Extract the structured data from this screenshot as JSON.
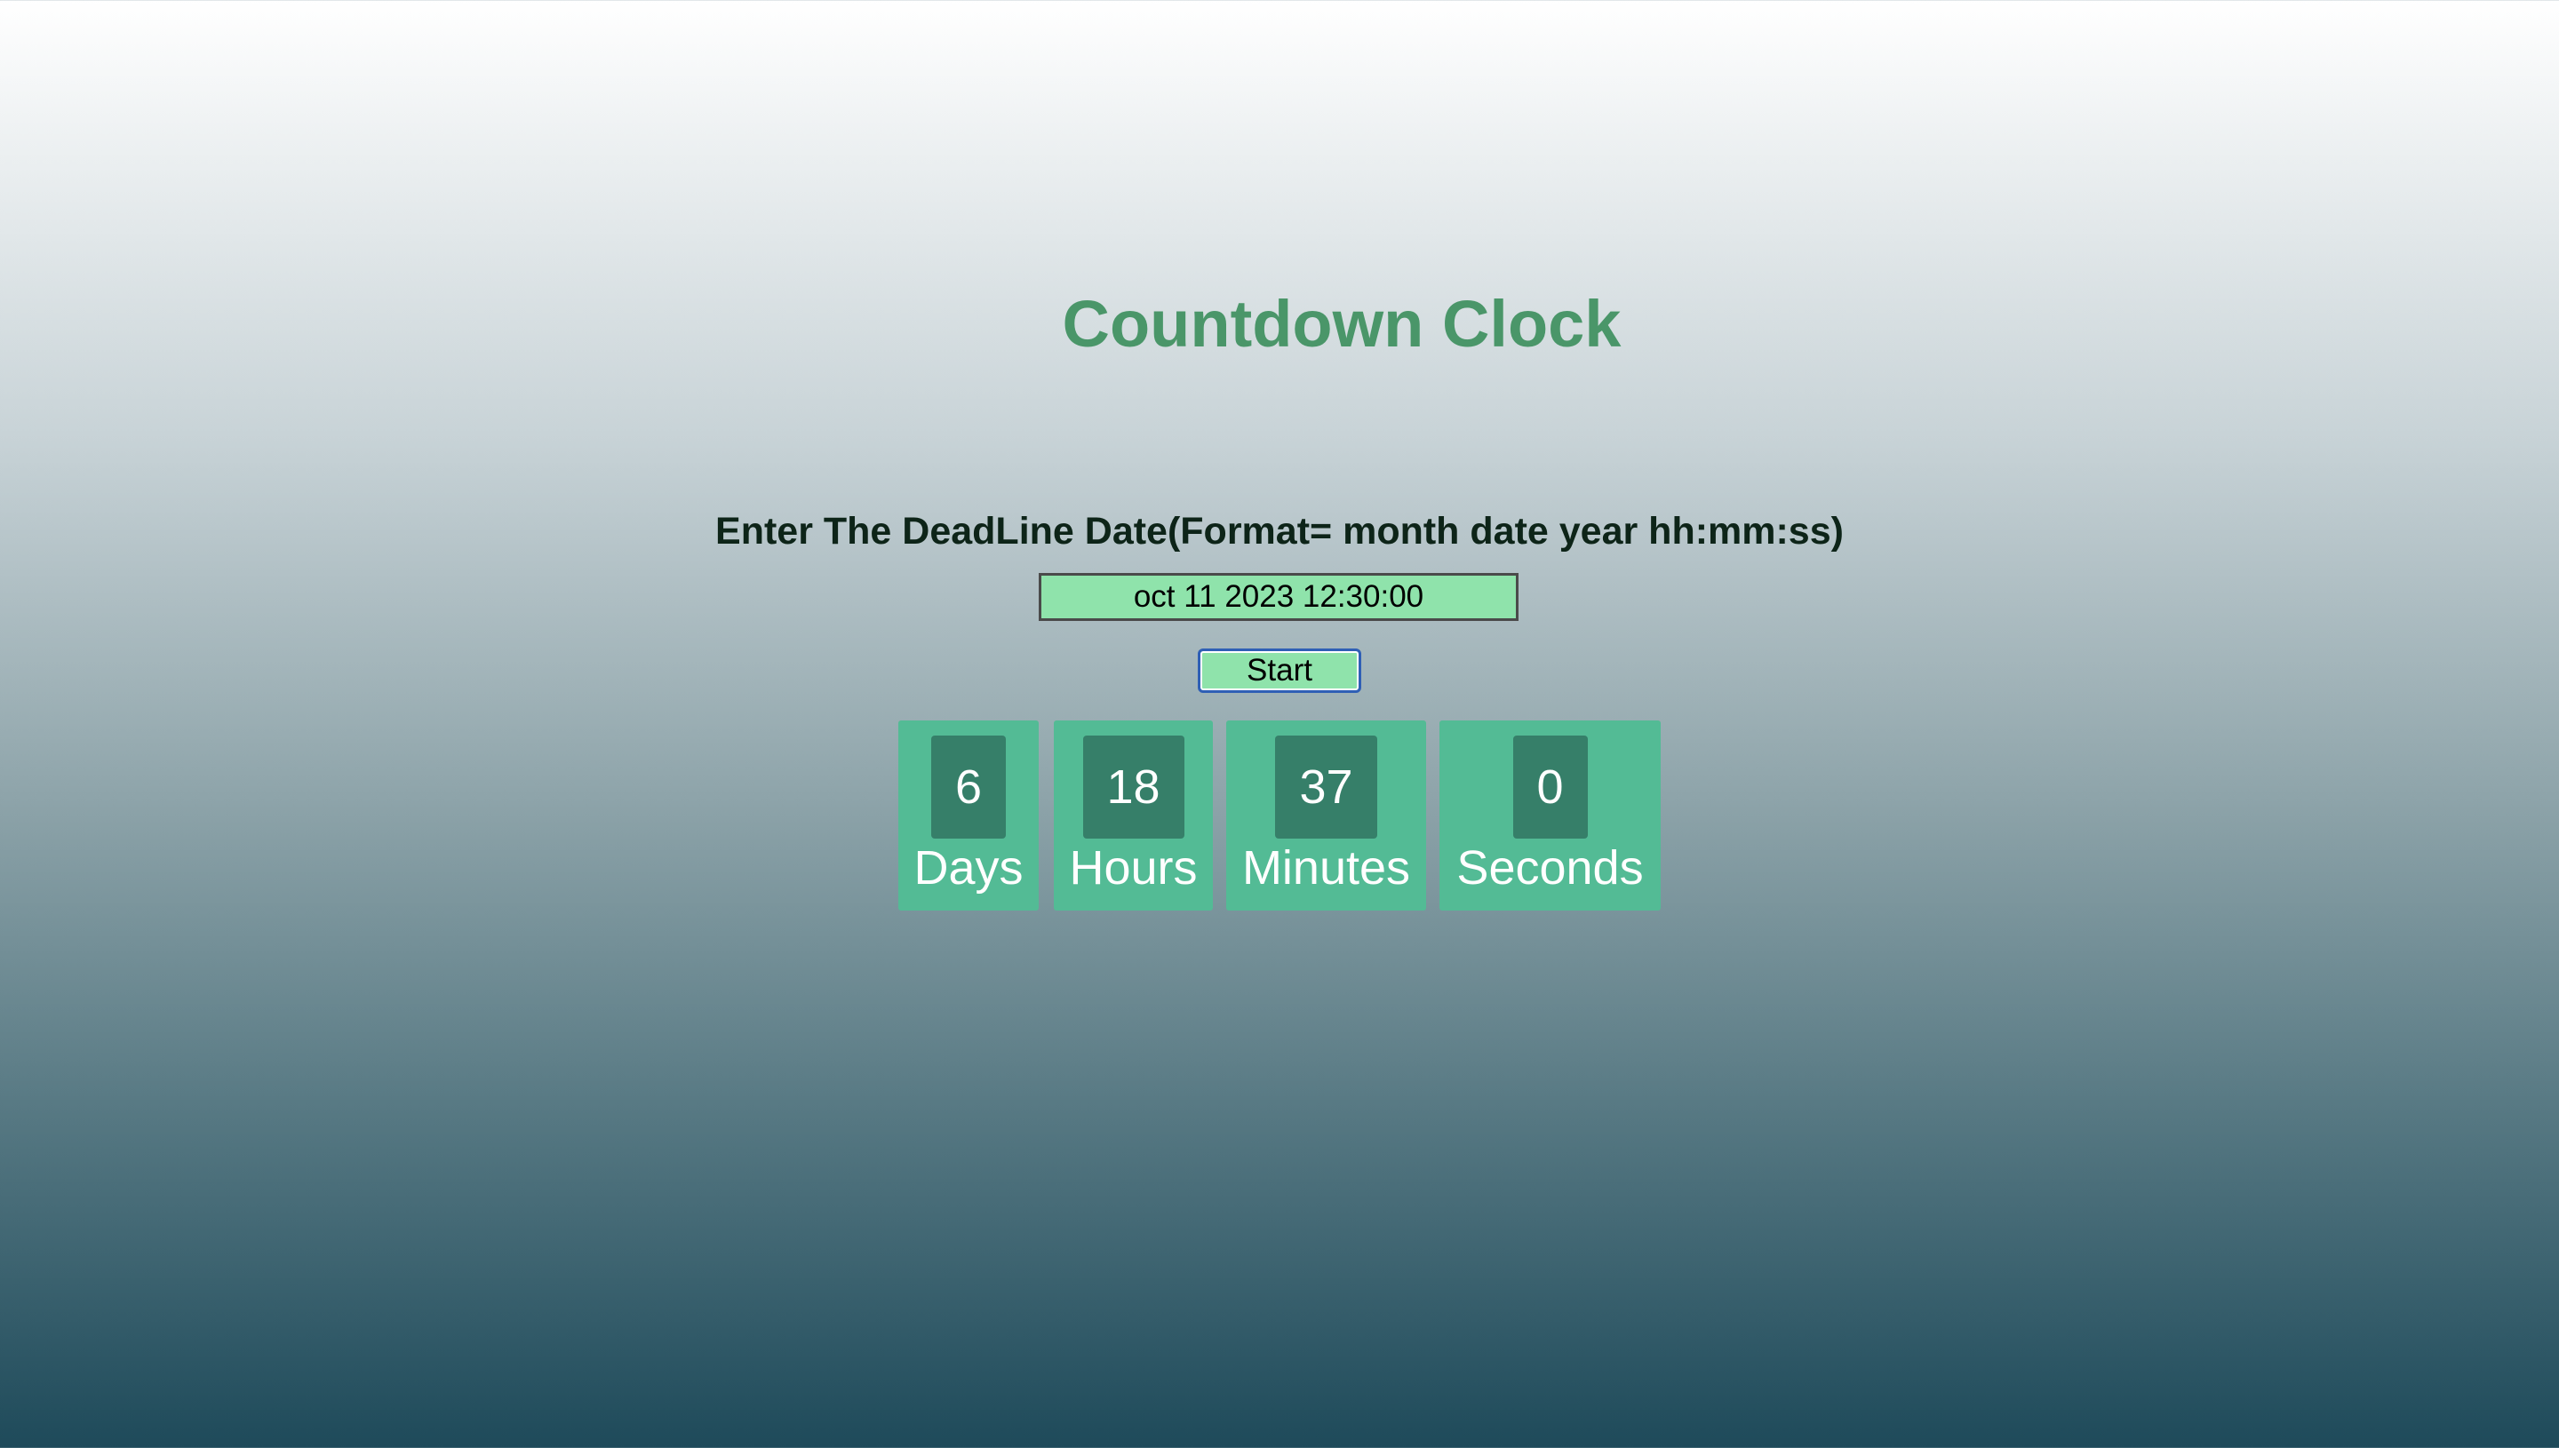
{
  "header": {
    "title": "Countdown Clock"
  },
  "form": {
    "prompt": "Enter The DeadLine Date(Format= month date year hh:mm:ss)",
    "deadline_value": "oct 11 2023 12:30:00",
    "start_label": "Start"
  },
  "clock": {
    "days": {
      "value": "6",
      "label": "Days"
    },
    "hours": {
      "value": "18",
      "label": "Hours"
    },
    "minutes": {
      "value": "37",
      "label": "Minutes"
    },
    "seconds": {
      "value": "0",
      "label": "Seconds"
    }
  },
  "colors": {
    "title": "#4a9669",
    "unit_background": "#53bb95",
    "value_background": "#367f69",
    "input_background": "#8fe3ab"
  }
}
